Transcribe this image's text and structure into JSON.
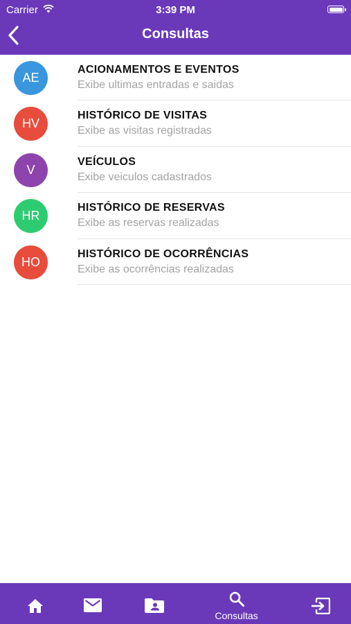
{
  "status_bar": {
    "carrier": "Carrier",
    "time": "3:39 PM"
  },
  "header": {
    "title": "Consultas"
  },
  "colors": {
    "primary": "#6a39b9"
  },
  "items": [
    {
      "initials": "AE",
      "color": "#3a97de",
      "title": "ACIONAMENTOS E EVENTOS",
      "subtitle": "Exibe ultimas entradas e saidas"
    },
    {
      "initials": "HV",
      "color": "#e74c3c",
      "title": "HISTÓRICO DE VISITAS",
      "subtitle": "Exibe as visitas registradas"
    },
    {
      "initials": "V",
      "color": "#8e44ad",
      "title": "VEÍCULOS",
      "subtitle": "Exibe veiculos cadastrados"
    },
    {
      "initials": "HR",
      "color": "#2ecc71",
      "title": "HISTÓRICO DE RESERVAS",
      "subtitle": "Exibe as reservas realizadas"
    },
    {
      "initials": "HO",
      "color": "#e74c3c",
      "title": "HISTÓRICO DE OCORRÊNCIAS",
      "subtitle": "Exibe as ocorrências realizadas"
    }
  ],
  "tabbar": {
    "tabs": [
      {
        "icon": "home-icon",
        "label": ""
      },
      {
        "icon": "mail-icon",
        "label": ""
      },
      {
        "icon": "contacts-folder-icon",
        "label": ""
      },
      {
        "icon": "search-icon",
        "label": "Consultas"
      },
      {
        "icon": "logout-icon",
        "label": ""
      }
    ]
  }
}
